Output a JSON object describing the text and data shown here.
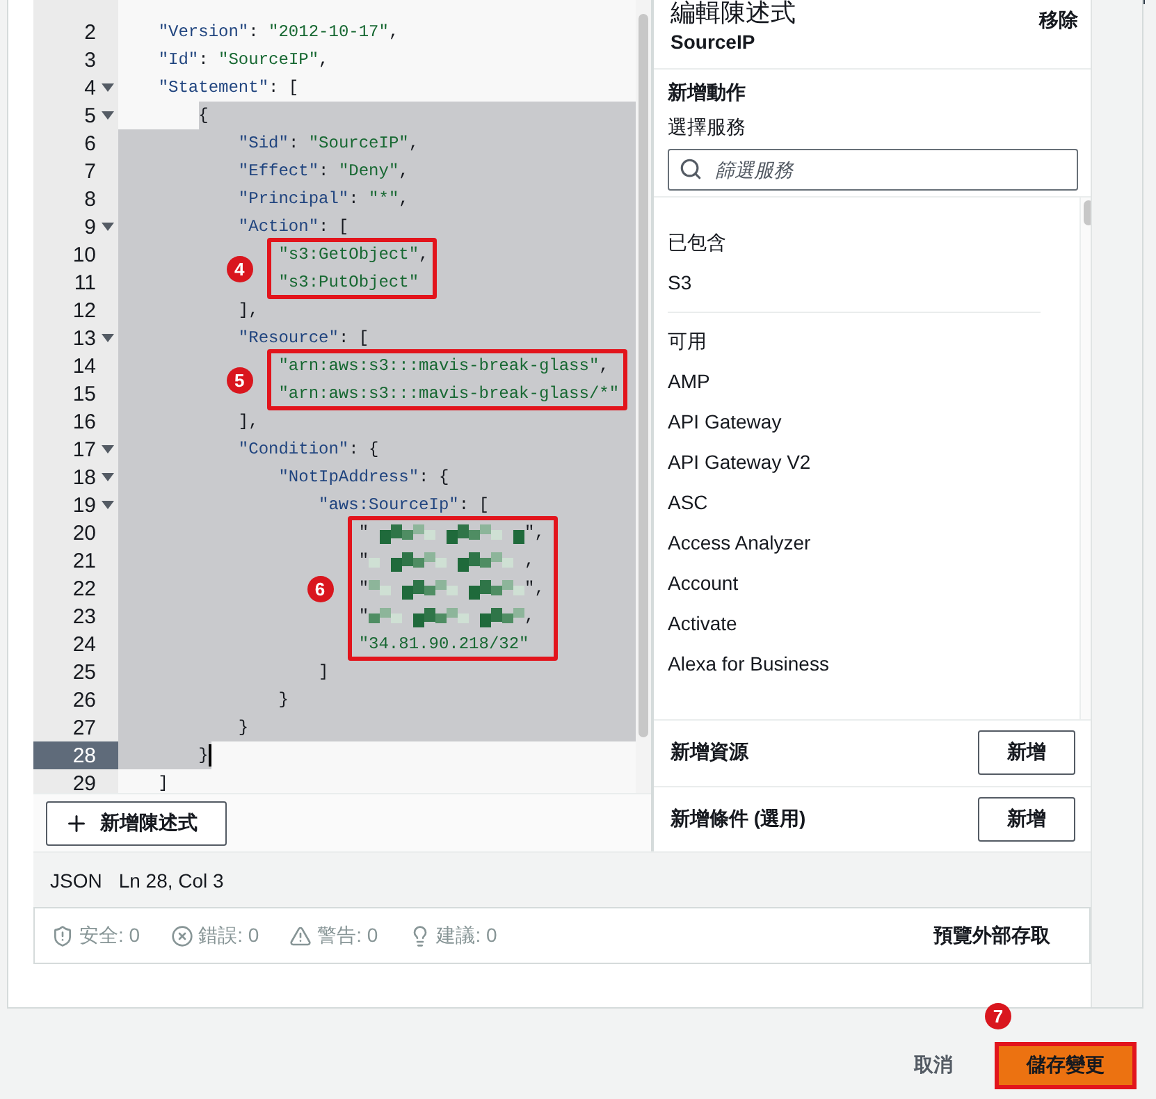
{
  "editor": {
    "blocks": [
      {
        "n": "2",
        "kind": "code",
        "text": "    \"Version\": \"2012-10-17\",",
        "foldable": false,
        "selected": false
      },
      {
        "n": "3",
        "kind": "code",
        "text": "    \"Id\": \"SourceIP\",",
        "foldable": false,
        "selected": false
      },
      {
        "n": "4",
        "kind": "code",
        "text": "    \"Statement\": [",
        "foldable": true,
        "selected": false
      },
      {
        "n": "5",
        "kind": "selection_start",
        "text": "        {",
        "foldable": true,
        "selected": true
      },
      {
        "n": "6",
        "kind": "code",
        "text": "            \"Sid\": \"SourceIP\",",
        "foldable": false,
        "selected": true
      },
      {
        "n": "7",
        "kind": "code",
        "text": "            \"Effect\": \"Deny\",",
        "foldable": false,
        "selected": true
      },
      {
        "n": "8",
        "kind": "code",
        "text": "            \"Principal\": \"*\",",
        "foldable": false,
        "selected": true
      },
      {
        "n": "9",
        "kind": "code",
        "text": "            \"Action\": [",
        "foldable": true,
        "selected": true
      },
      {
        "kind": "callout",
        "badge": "4",
        "lines": [
          {
            "n": "10",
            "kind": "code",
            "text": "                \"s3:GetObject\",",
            "foldable": false,
            "selected": true
          },
          {
            "n": "11",
            "kind": "code",
            "text": "                \"s3:PutObject\"",
            "foldable": false,
            "selected": true
          }
        ]
      },
      {
        "n": "12",
        "kind": "code",
        "text": "            ],",
        "foldable": false,
        "selected": true
      },
      {
        "n": "13",
        "kind": "code",
        "text": "            \"Resource\": [",
        "foldable": true,
        "selected": true
      },
      {
        "kind": "callout",
        "badge": "5",
        "lines": [
          {
            "n": "14",
            "kind": "code",
            "text": "                \"arn:aws:s3:::mavis-break-glass\",",
            "foldable": false,
            "selected": true
          },
          {
            "n": "15",
            "kind": "code",
            "text": "                \"arn:aws:s3:::mavis-break-glass/*\"",
            "foldable": false,
            "selected": true
          }
        ]
      },
      {
        "n": "16",
        "kind": "code",
        "text": "            ],",
        "foldable": false,
        "selected": true
      },
      {
        "n": "17",
        "kind": "code",
        "text": "            \"Condition\": {",
        "foldable": true,
        "selected": true
      },
      {
        "n": "18",
        "kind": "code",
        "text": "                \"NotIpAddress\": {",
        "foldable": true,
        "selected": true
      },
      {
        "n": "19",
        "kind": "code",
        "text": "                    \"aws:SourceIp\": [",
        "foldable": true,
        "selected": true
      },
      {
        "kind": "callout",
        "badge": "6",
        "lines": [
          {
            "n": "20",
            "kind": "redacted",
            "text": "                        \"",
            "suffix": "\",",
            "foldable": false,
            "selected": true
          },
          {
            "n": "21",
            "kind": "redacted",
            "text": "                        \"",
            "suffix": ",",
            "foldable": false,
            "selected": true
          },
          {
            "n": "22",
            "kind": "redacted",
            "text": "                        \"",
            "suffix": "\",",
            "foldable": false,
            "selected": true
          },
          {
            "n": "23",
            "kind": "redacted",
            "text": "                        \"",
            "suffix": ",",
            "foldable": false,
            "selected": true
          },
          {
            "n": "24",
            "kind": "code",
            "text": "                        \"34.81.90.218/32\"",
            "foldable": false,
            "selected": true
          }
        ]
      },
      {
        "n": "25",
        "kind": "code",
        "text": "                    ]",
        "foldable": false,
        "selected": true
      },
      {
        "n": "26",
        "kind": "code",
        "text": "                }",
        "foldable": false,
        "selected": true
      },
      {
        "n": "27",
        "kind": "code",
        "text": "            }",
        "foldable": false,
        "selected": true
      },
      {
        "n": "28",
        "kind": "selection_end",
        "text": "        }",
        "foldable": false,
        "selected": true,
        "active": true,
        "cursor": true
      },
      {
        "n": "29",
        "kind": "code",
        "text": "    ]",
        "foldable": false,
        "selected": false
      }
    ],
    "add_statement_button": "新增陳述式"
  },
  "panel": {
    "title": "編輯陳述式",
    "remove_link": "移除",
    "statement_id": "SourceIP",
    "add_action": {
      "heading": "新增動作",
      "label": "選擇服務",
      "search": {
        "placeholder": "篩選服務"
      }
    },
    "service_sections": [
      {
        "heading": "已包含",
        "items": [
          "S3"
        ]
      },
      {
        "heading": "可用",
        "items": [
          "AMP",
          "API Gateway",
          "API Gateway V2",
          "ASC",
          "Access Analyzer",
          "Account",
          "Activate",
          "Alexa for Business"
        ]
      }
    ],
    "rows": [
      {
        "label": "新增資源",
        "button": "新增"
      },
      {
        "label": "新增條件 (選用)",
        "button": "新增"
      }
    ]
  },
  "status_bar": {
    "mode": "JSON",
    "position": "Ln 28, Col 3"
  },
  "validation": {
    "items": [
      {
        "kind": "security",
        "label": "安全: 0"
      },
      {
        "kind": "error",
        "label": "錯誤: 0"
      },
      {
        "kind": "warning",
        "label": "警告: 0"
      },
      {
        "kind": "suggestion",
        "label": "建議: 0"
      }
    ],
    "preview_link": "預覽外部存取"
  },
  "footer": {
    "cancel": "取消",
    "save": {
      "label": "儲存變更",
      "badge": "7"
    }
  }
}
